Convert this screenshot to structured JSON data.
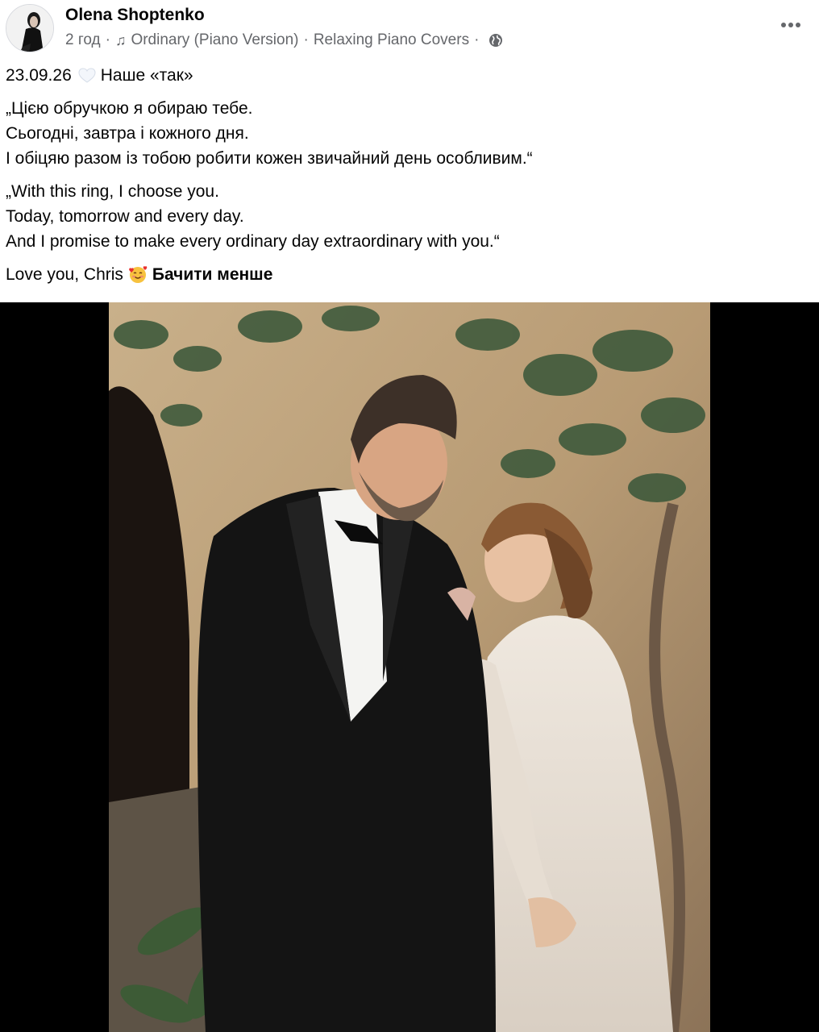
{
  "post": {
    "author": "Olena Shoptenko",
    "time": "2 год",
    "song_title": "Ordinary (Piano Version)",
    "song_artist": "Relaxing Piano Covers",
    "separator": "·",
    "privacy_icon": "globe-icon",
    "music_icon": "music-note-icon",
    "more_icon": "more-dots-icon"
  },
  "text": {
    "date": "23.09.26",
    "heart_icon": "white-heart-icon",
    "title": "Наше «так»",
    "ua_lines": [
      "„Цією обручкою я обираю тебе.",
      "Сьогодні, завтра і кожного дня.",
      "І обіцяю разом із тобою робити кожен звичайний день особливим.“"
    ],
    "en_lines": [
      "„With this ring, I choose you.",
      "Today, tomorrow and every day.",
      "And I promise to make every ordinary day extraordinary with you.“"
    ],
    "signoff": "Love you, Chris",
    "signoff_emoji": "smiling-face-with-hearts-icon",
    "see_less": "Бачити менше"
  },
  "media": {
    "description_icon": "wedding-photo"
  }
}
